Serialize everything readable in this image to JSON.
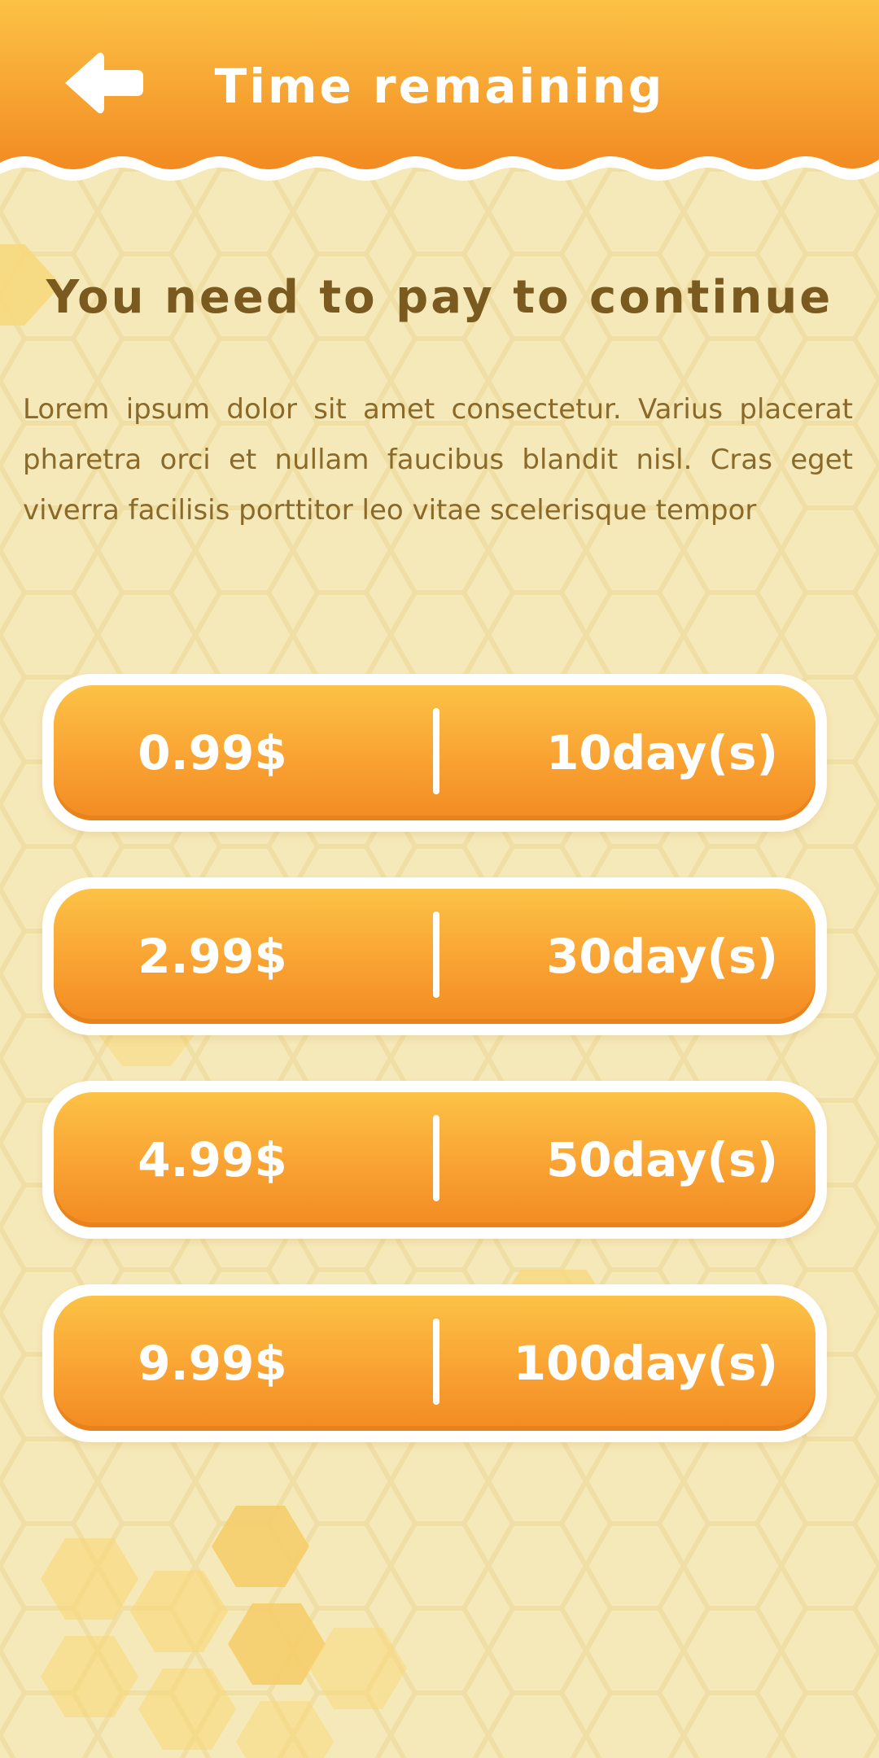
{
  "header": {
    "title": "Time remaining",
    "back_icon": "arrow-left-icon"
  },
  "main": {
    "headline": "You need to pay to continue",
    "description": "Lorem ipsum dolor sit amet consectetur. Varius placerat pharetra orci et nullam faucibus blandit nisl. Cras eget viverra facilisis porttitor leo vitae scelerisque tempor"
  },
  "plans": [
    {
      "price": "0.99$",
      "duration": "10day(s)"
    },
    {
      "price": "2.99$",
      "duration": "30day(s)"
    },
    {
      "price": "4.99$",
      "duration": "50day(s)"
    },
    {
      "price": "9.99$",
      "duration": "100day(s)"
    }
  ],
  "colors": {
    "background": "#f6e9b9",
    "header_top": "#fcc246",
    "header_bottom": "#f28b22",
    "headline_text": "#7a5a1f",
    "body_text": "#8a6a2a",
    "button_gradient_top": "#fcc246",
    "button_gradient_bottom": "#f28b22"
  }
}
